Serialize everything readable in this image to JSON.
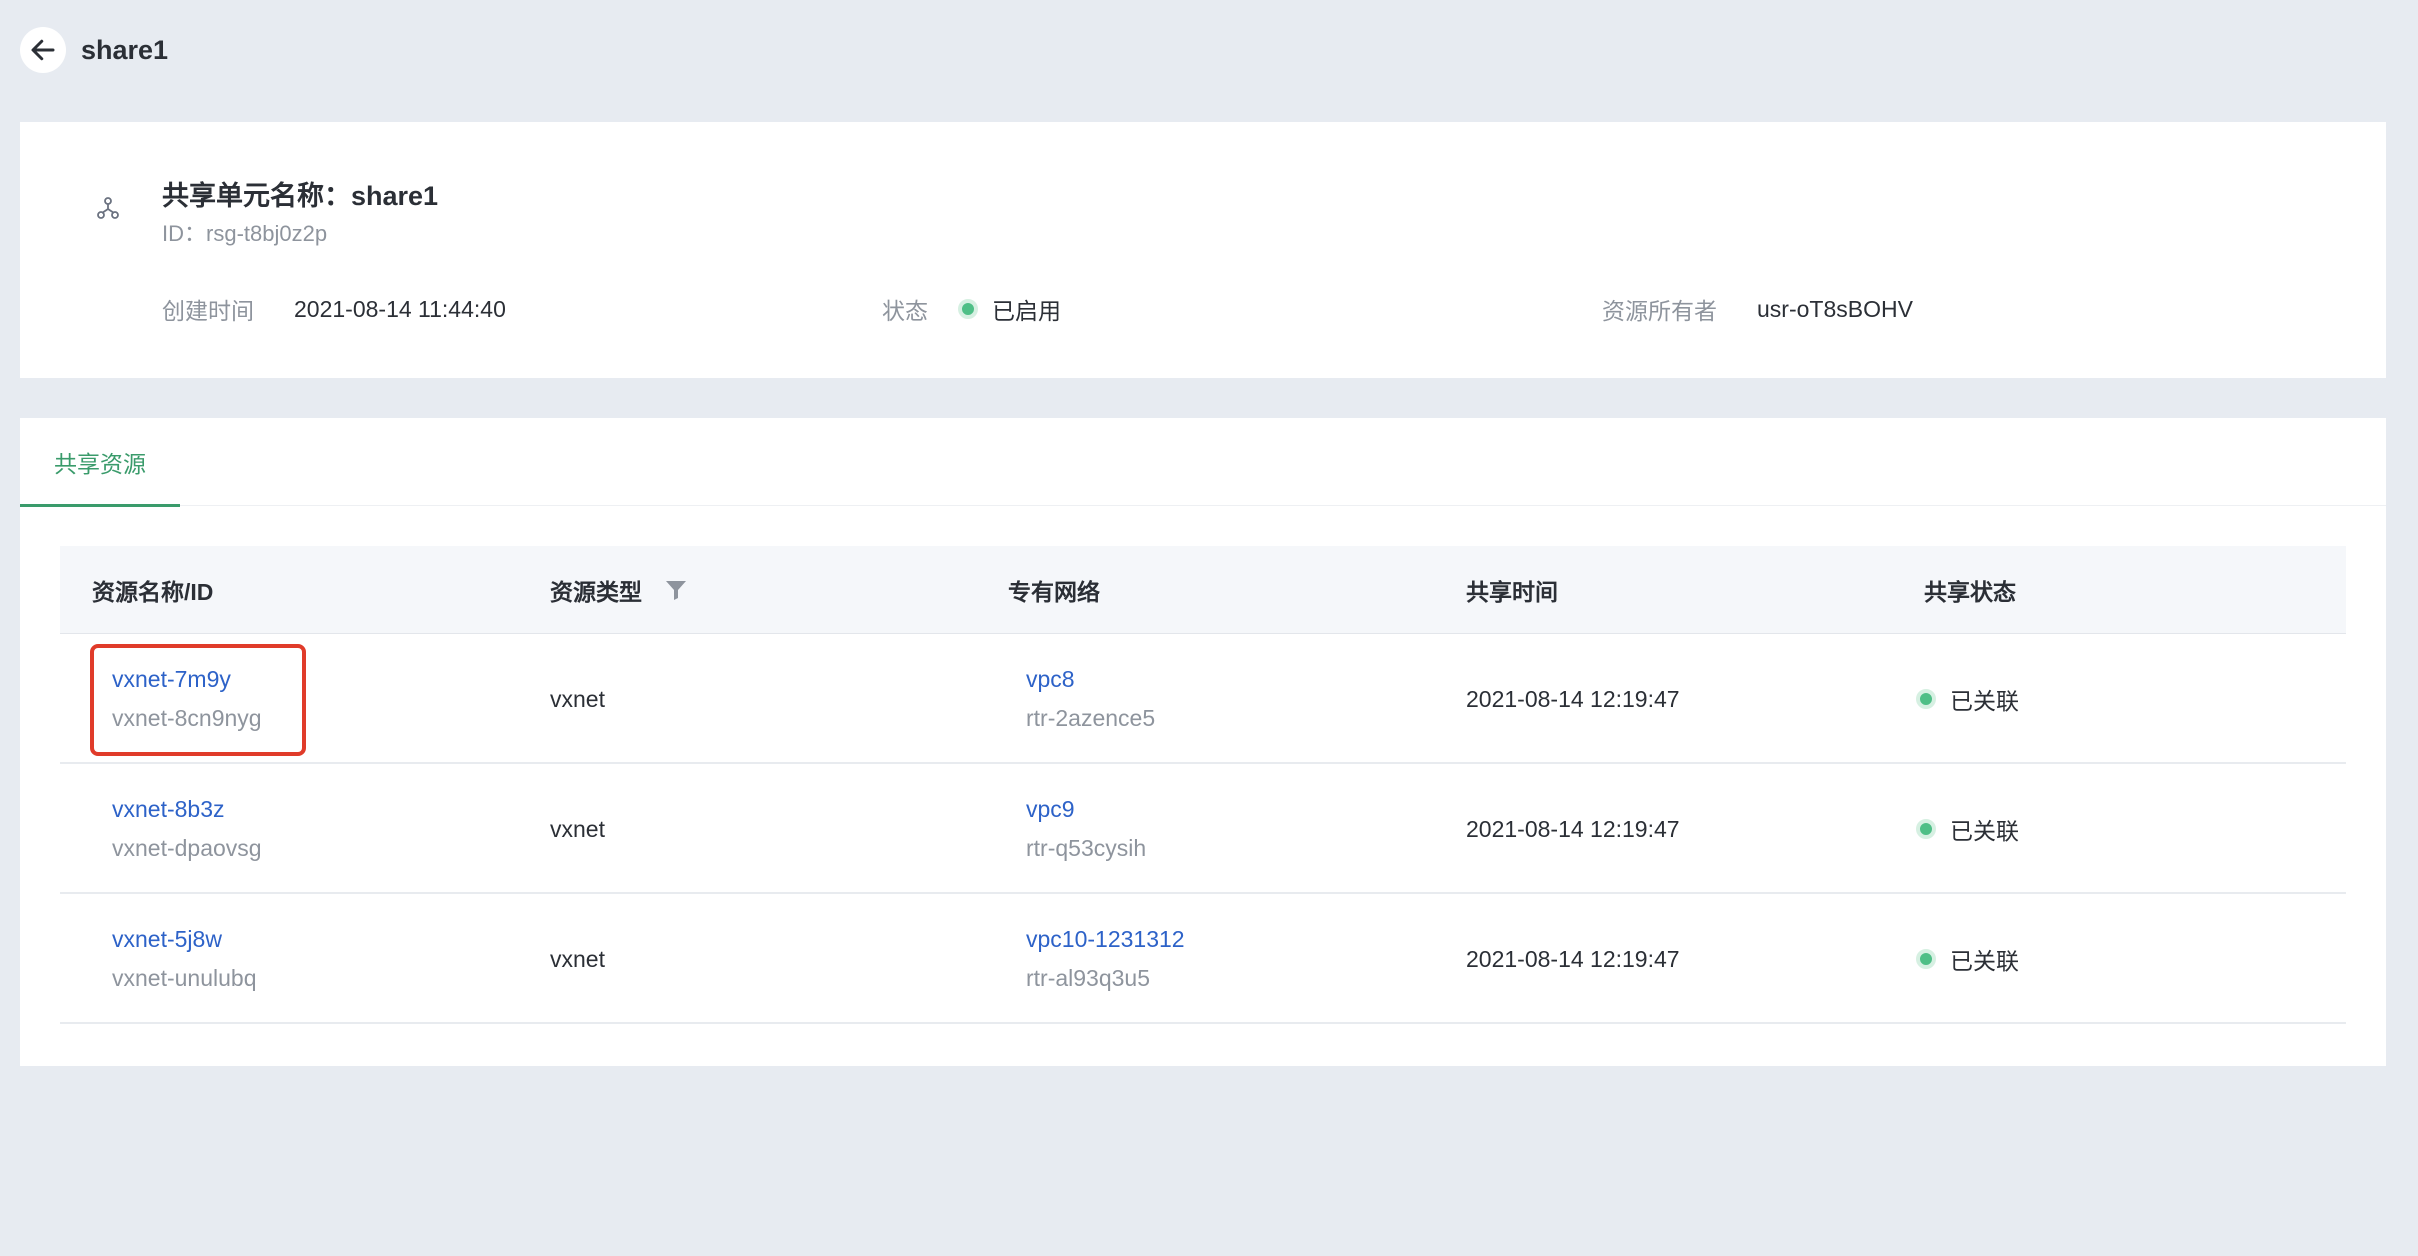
{
  "header": {
    "title": "share1"
  },
  "info": {
    "name_label": "共享单元名称：",
    "name_value": "share1",
    "id_label": "ID：",
    "id_value": "rsg-t8bj0z2p",
    "created_label": "创建时间",
    "created_value": "2021-08-14 11:44:40",
    "status_label": "状态",
    "status_value": "已启用",
    "owner_label": "资源所有者",
    "owner_value": "usr-oT8sBOHV"
  },
  "tabs": [
    {
      "label": "共享资源"
    }
  ],
  "table": {
    "columns": [
      "资源名称/ID",
      "资源类型",
      "专有网络",
      "共享时间",
      "共享状态"
    ],
    "rows": [
      {
        "name": "vxnet-7m9y",
        "id": "vxnet-8cn9nyg",
        "type": "vxnet",
        "vpc": "vpc8",
        "router": "rtr-2azence5",
        "time": "2021-08-14 12:19:47",
        "status": "已关联"
      },
      {
        "name": "vxnet-8b3z",
        "id": "vxnet-dpaovsg",
        "type": "vxnet",
        "vpc": "vpc9",
        "router": "rtr-q53cysih",
        "time": "2021-08-14 12:19:47",
        "status": "已关联"
      },
      {
        "name": "vxnet-5j8w",
        "id": "vxnet-unulubq",
        "type": "vxnet",
        "vpc": "vpc10-1231312",
        "router": "rtr-al93q3u5",
        "time": "2021-08-14 12:19:47",
        "status": "已关联"
      }
    ]
  },
  "colors": {
    "accent": "#3a9b6b",
    "link": "#2d62c8",
    "status_green": "#4fbf87",
    "highlight": "#e03b2a"
  },
  "icons": {
    "back": "arrow-left-icon",
    "unit": "share-unit-icon",
    "filter": "filter-icon"
  }
}
